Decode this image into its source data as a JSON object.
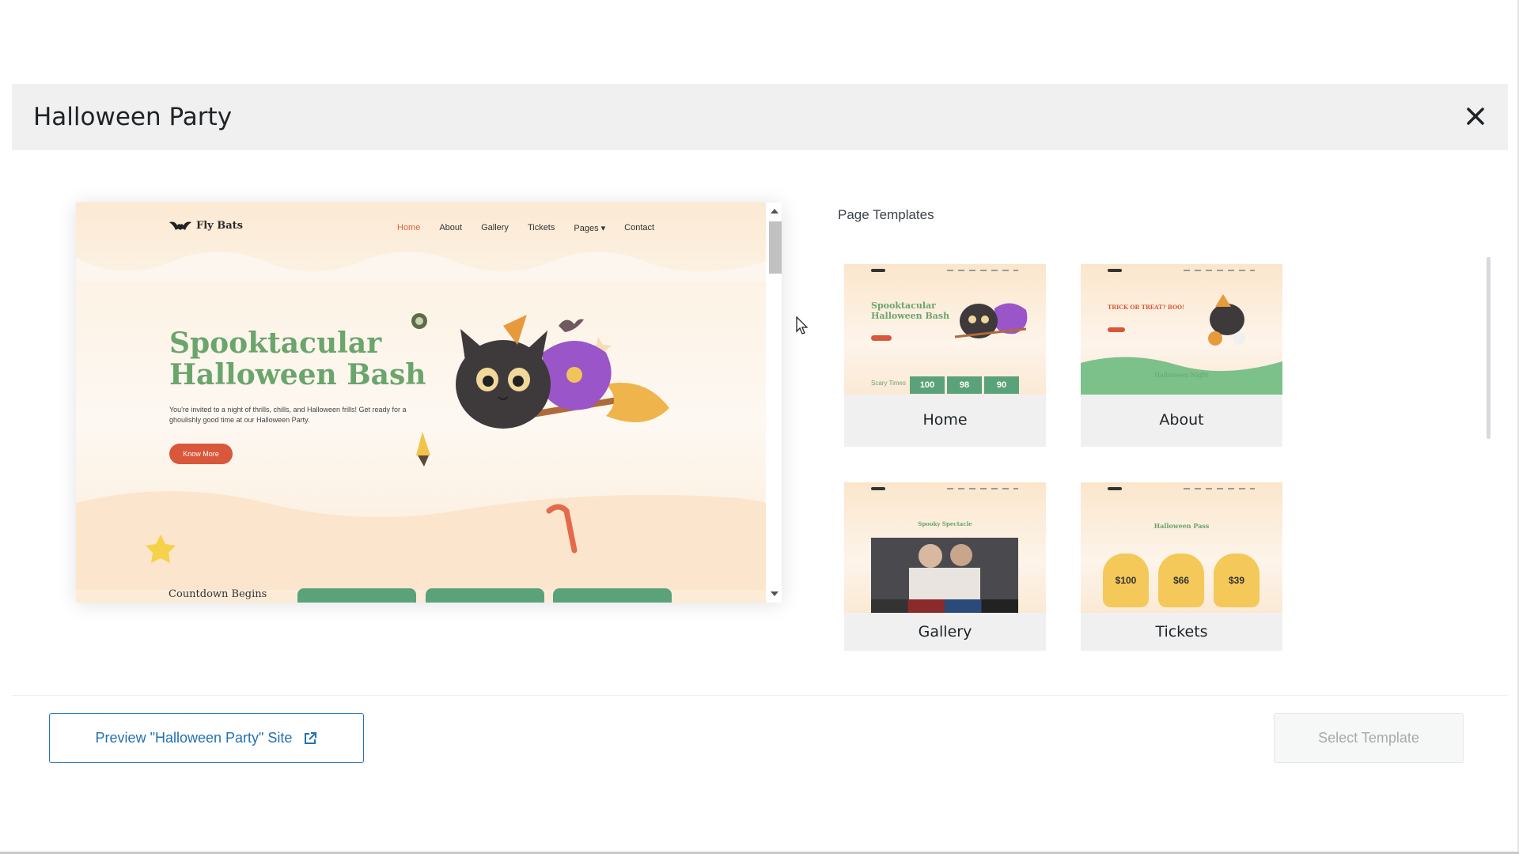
{
  "modal": {
    "title": "Halloween Party"
  },
  "preview_site": {
    "logo_text": "Fly Bats",
    "menu": [
      "Home",
      "About",
      "Gallery",
      "Tickets",
      "Pages ▾",
      "Contact"
    ],
    "hero_title": "Spooktacular Halloween Bash",
    "hero_text": "You're invited to a night of thrills, chills, and Halloween frills! Get ready for a ghoulishly good time at our Halloween Party.",
    "hero_button": "Know More",
    "countdown_title": "Countdown Begins"
  },
  "templates": {
    "label": "Page Templates",
    "items": [
      {
        "name": "Home",
        "thumb_title": "Spooktacular Halloween Bash",
        "counts": [
          "100",
          "98",
          "90"
        ],
        "thumb_sub": "Scary Times"
      },
      {
        "name": "About",
        "thumb_title": "TRICK OR TREAT? BOO!",
        "thumb_sub": "Halloween Night"
      },
      {
        "name": "Gallery",
        "thumb_title": "Spooky Spectacle"
      },
      {
        "name": "Tickets",
        "thumb_title": "Halloween Pass",
        "prices": [
          "$100",
          "$66",
          "$39"
        ]
      }
    ]
  },
  "footer": {
    "preview_label": "Preview \"Halloween Party\" Site",
    "select_label": "Select Template"
  },
  "colors": {
    "accent": "#2271b1",
    "hero_green": "#6aa56c",
    "button_orange": "#d9573a"
  }
}
